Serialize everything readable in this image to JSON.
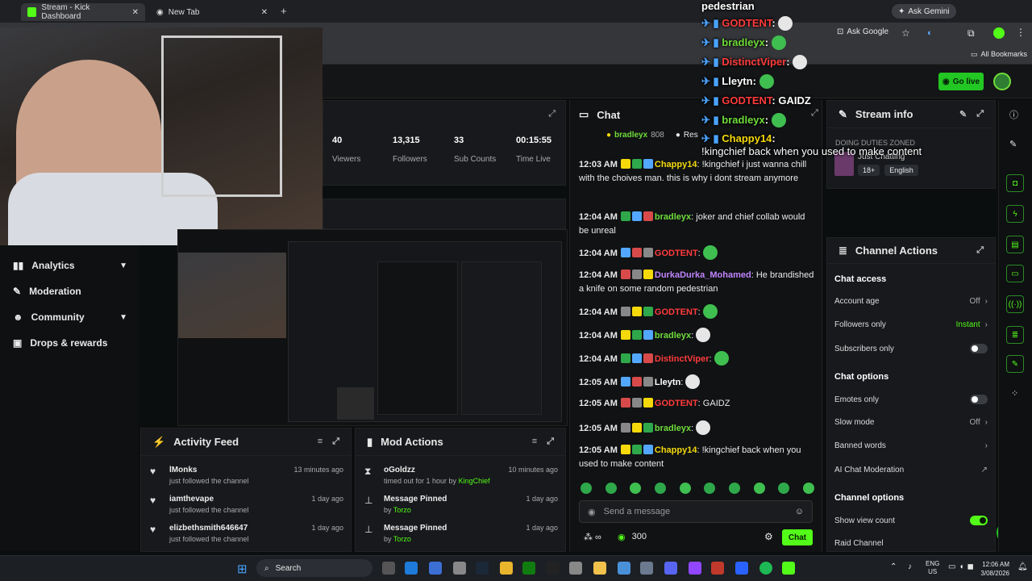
{
  "browser": {
    "tabs": [
      {
        "label": "Stream - Kick Dashboard",
        "active": true
      },
      {
        "label": "New Tab",
        "active": false
      }
    ],
    "ask_gemini": "Ask Gemini",
    "ask_google": "Ask Google",
    "all_bookmarks": "All Bookmarks"
  },
  "header": {
    "go_live": "Go live"
  },
  "sidebar": {
    "items": [
      {
        "label": "Analytics",
        "icon": "chart-icon",
        "expandable": true
      },
      {
        "label": "Moderation",
        "icon": "wrench-icon",
        "expandable": false
      },
      {
        "label": "Community",
        "icon": "people-icon",
        "expandable": true
      },
      {
        "label": "Drops & rewards",
        "icon": "gift-icon",
        "expandable": false
      }
    ]
  },
  "stats": [
    {
      "value": "40",
      "label": "Viewers"
    },
    {
      "value": "13,315",
      "label": "Followers"
    },
    {
      "value": "33",
      "label": "Sub Counts"
    },
    {
      "value": "00:15:55",
      "label": "Time Live"
    }
  ],
  "activity_feed": {
    "title": "Activity Feed",
    "items": [
      {
        "name": "lMonks",
        "text": "just followed the channel",
        "time": "13 minutes ago"
      },
      {
        "name": "iamthevape",
        "text": "just followed the channel",
        "time": "1 day ago"
      },
      {
        "name": "elizbethsmith646647",
        "text": "just followed the channel",
        "time": "1 day ago"
      }
    ]
  },
  "mod_actions": {
    "title": "Mod Actions",
    "items": [
      {
        "name": "oGoldzz",
        "text": "timed out for 1 hour by",
        "by": "KingChief",
        "time": "10 minutes ago"
      },
      {
        "name": "Message Pinned",
        "text": "by",
        "by": "Torzo",
        "time": "1 day ago"
      },
      {
        "name": "Message Pinned",
        "text": "by",
        "by": "Torzo",
        "time": "1 day ago"
      }
    ]
  },
  "chat": {
    "title": "Chat",
    "top_gifter": {
      "name": "bradleyx",
      "count": "808"
    },
    "top_gifter_cut": "Res",
    "messages": [
      {
        "time": "12:03 AM",
        "user": "Chappy14",
        "color": "#f5d90a",
        "text": "!kingchief i just wanna chill with the choives man. this is why i dont stream anymore"
      },
      {
        "time": "12:04 AM",
        "user": "bradleyx",
        "color": "#6fdc3a",
        "text": "joker and chief collab would be unreal"
      },
      {
        "time": "12:04 AM",
        "user": "GODTENT",
        "color": "#ff3b3b",
        "text": ""
      },
      {
        "time": "12:04 AM",
        "user": "DurkaDurka_Mohamed",
        "color": "#c084fc",
        "text": "He brandished a knife on some random pedestrian"
      },
      {
        "time": "12:04 AM",
        "user": "GODTENT",
        "color": "#ff3b3b",
        "text": ""
      },
      {
        "time": "12:04 AM",
        "user": "bradleyx",
        "color": "#6fdc3a",
        "text": ""
      },
      {
        "time": "12:04 AM",
        "user": "DistinctViper",
        "color": "#ff3b3b",
        "text": ""
      },
      {
        "time": "12:05 AM",
        "user": "Lleytn",
        "color": "#ffffff",
        "text": ""
      },
      {
        "time": "12:05 AM",
        "user": "GODTENT",
        "color": "#ff3b3b",
        "text": "GAIDZ"
      },
      {
        "time": "12:05 AM",
        "user": "bradleyx",
        "color": "#6fdc3a",
        "text": ""
      },
      {
        "time": "12:05 AM",
        "user": "Chappy14",
        "color": "#f5d90a",
        "text": "!kingchief back when you used to make content"
      }
    ],
    "input_placeholder": "Send a message",
    "points": "300",
    "send_label": "Chat"
  },
  "stream_info": {
    "title": "Stream info",
    "category": "Just Chatting",
    "tags": [
      "18+",
      "English"
    ],
    "stream_title_cut": "DOING DUTIES ZONED"
  },
  "channel_actions": {
    "title": "Channel Actions",
    "chat_access": {
      "title": "Chat access",
      "rows": [
        {
          "label": "Account age",
          "value": "Off",
          "kind": "chevron"
        },
        {
          "label": "Followers only",
          "value": "Instant",
          "kind": "chevron"
        },
        {
          "label": "Subscribers only",
          "value": "",
          "kind": "toggle",
          "on": false
        }
      ]
    },
    "chat_options": {
      "title": "Chat options",
      "rows": [
        {
          "label": "Emotes only",
          "value": "",
          "kind": "toggle",
          "on": false
        },
        {
          "label": "Slow mode",
          "value": "Off",
          "kind": "chevron"
        },
        {
          "label": "Banned words",
          "value": "",
          "kind": "chevron"
        },
        {
          "label": "AI Chat Moderation",
          "value": "",
          "kind": "external"
        }
      ]
    },
    "channel_options": {
      "title": "Channel options",
      "rows": [
        {
          "label": "Show view count",
          "value": "",
          "kind": "toggle",
          "on": true
        },
        {
          "label": "Raid Channel",
          "value": "",
          "kind": "none"
        }
      ]
    }
  },
  "overlay_chat": [
    {
      "user": "",
      "text": "pedestrian"
    },
    {
      "user": "GODTENT",
      "color": "#ff3b3b",
      "text": ""
    },
    {
      "user": "bradleyx",
      "color": "#6fdc3a",
      "text": ""
    },
    {
      "user": "DistinctViper",
      "color": "#ff3b3b",
      "text": ""
    },
    {
      "user": "Lleytn",
      "color": "#ffffff",
      "text": ""
    },
    {
      "user": "GODTENT",
      "color": "#ff3b3b",
      "text": "GAIDZ"
    },
    {
      "user": "bradleyx",
      "color": "#6fdc3a",
      "text": ""
    },
    {
      "user": "Chappy14",
      "color": "#f5d90a",
      "text": "!kingchief back when you used to make content"
    }
  ],
  "taskbar": {
    "search": "Search",
    "lang_top": "ENG",
    "lang_bottom": "US",
    "time": "12:06 AM",
    "date": "3/08/2026"
  },
  "colors": {
    "kick_green": "#53fc18",
    "panel": "#17191c",
    "bg": "#0b0e0f"
  }
}
